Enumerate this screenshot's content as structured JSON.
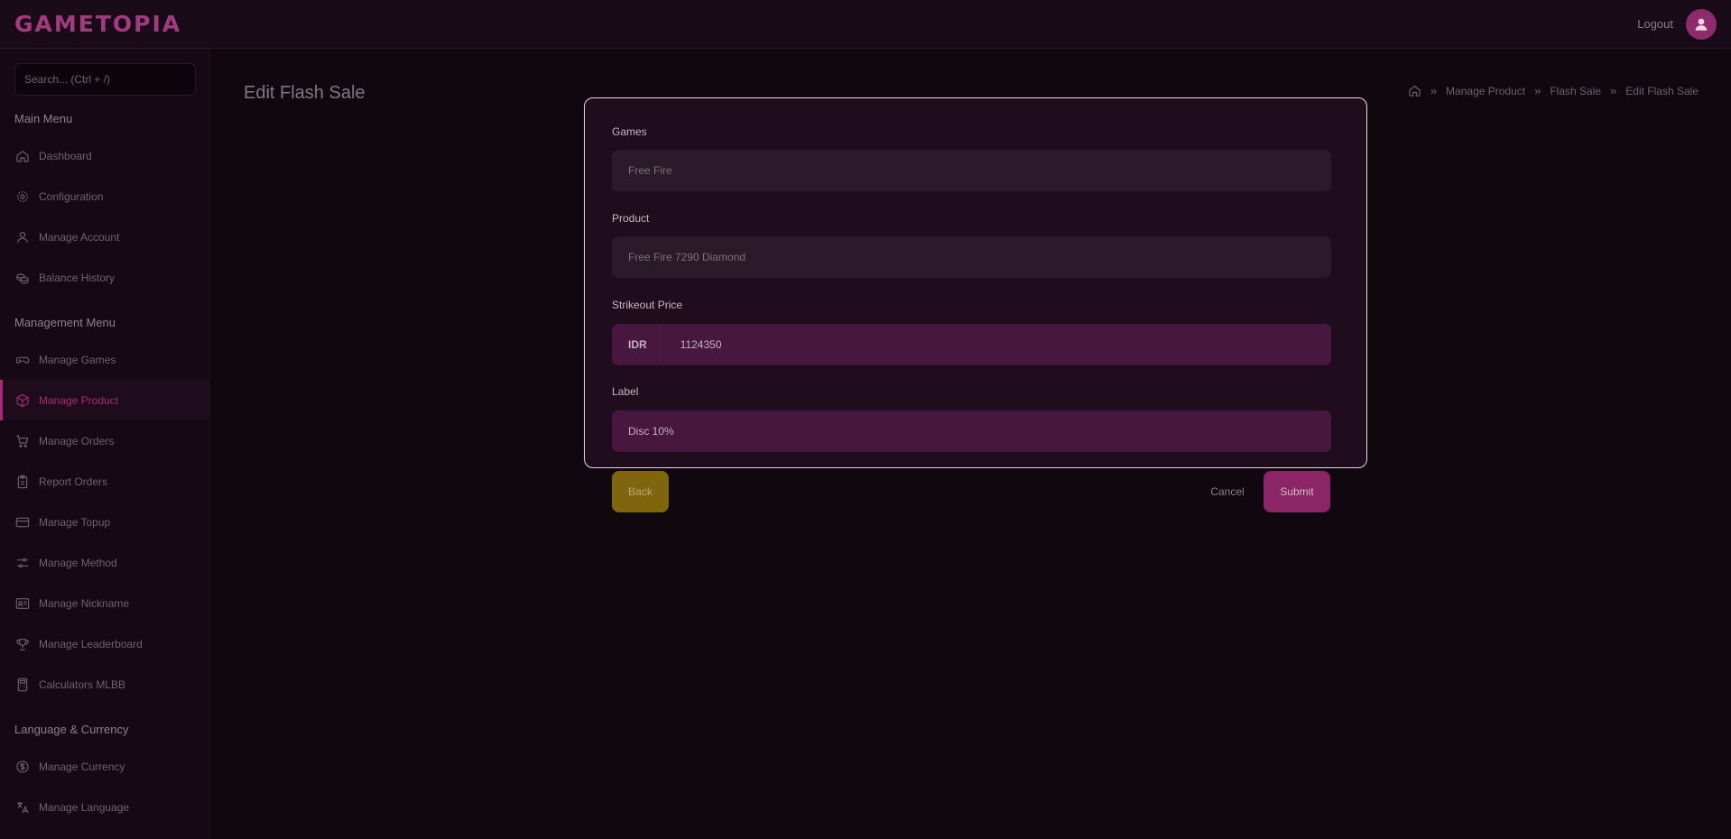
{
  "header": {
    "logo": "GAMETOPIA",
    "logout_label": "Logout"
  },
  "sidebar": {
    "search_placeholder": "Search... (Ctrl + /)",
    "sections": [
      {
        "title": "Main Menu",
        "items": [
          {
            "label": "Dashboard",
            "icon": "home-icon"
          },
          {
            "label": "Configuration",
            "icon": "gear-icon"
          },
          {
            "label": "Manage Account",
            "icon": "user-icon"
          },
          {
            "label": "Balance History",
            "icon": "coins-icon"
          }
        ]
      },
      {
        "title": "Management Menu",
        "items": [
          {
            "label": "Manage Games",
            "icon": "gamepad-icon"
          },
          {
            "label": "Manage Product",
            "icon": "box-icon",
            "active": true
          },
          {
            "label": "Manage Orders",
            "icon": "cart-icon"
          },
          {
            "label": "Report Orders",
            "icon": "clipboard-icon"
          },
          {
            "label": "Manage Topup",
            "icon": "credit-card-icon"
          },
          {
            "label": "Manage Method",
            "icon": "sliders-icon"
          },
          {
            "label": "Manage Nickname",
            "icon": "id-card-icon"
          },
          {
            "label": "Manage Leaderboard",
            "icon": "trophy-icon"
          },
          {
            "label": "Calculators MLBB",
            "icon": "calculator-icon"
          }
        ]
      },
      {
        "title": "Language & Currency",
        "items": [
          {
            "label": "Manage Currency",
            "icon": "dollar-circle-icon"
          },
          {
            "label": "Manage Language",
            "icon": "translate-icon"
          }
        ]
      }
    ]
  },
  "page": {
    "title": "Edit Flash Sale",
    "breadcrumb": [
      "Manage Product",
      "Flash Sale",
      "Edit Flash Sale"
    ]
  },
  "form": {
    "games_label": "Games",
    "games_value": "Free Fire",
    "product_label": "Product",
    "product_value": "Free Fire 7290 Diamond",
    "strikeout_label": "Strikeout Price",
    "currency_prefix": "IDR",
    "strikeout_value": "1124350",
    "label_label": "Label",
    "label_value": "Disc 10%"
  },
  "actions": {
    "back": "Back",
    "cancel": "Cancel",
    "submit": "Submit"
  },
  "colors": {
    "accent": "#a8287a",
    "back_button": "#80650f",
    "submit_button": "#8a2566"
  }
}
